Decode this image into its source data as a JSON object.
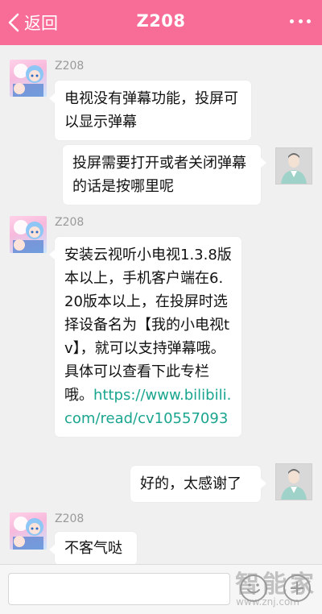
{
  "header": {
    "back_label": "返回",
    "title": "Z208"
  },
  "messages": [
    {
      "sender": "Z208",
      "side": "left",
      "text": "电视没有弹幕功能，投屏可以显示弹幕"
    },
    {
      "sender": "",
      "side": "right",
      "text": "投屏需要打开或者关闭弹幕的话是按哪里呢"
    },
    {
      "sender": "Z208",
      "side": "left",
      "text": "安装云视听小电视1.3.8版本以上，手机客户端在6.20版本以上，在投屏时选择设备名为【我的小电视tv】，就可以支持弹幕哦。具体可以查看下此专栏哦。",
      "link": "https://www.bilibili.com/read/cv10557093"
    },
    {
      "sender": "",
      "side": "right",
      "text": "好的，太感谢了"
    },
    {
      "sender": "Z208",
      "side": "left",
      "text": "不客气哒"
    }
  ],
  "input": {
    "placeholder": "",
    "emoji_icon": "smiley-icon",
    "plus_icon": "plus-icon"
  },
  "watermark": {
    "logo": "智能家",
    "site": "www.znj.com"
  },
  "colors": {
    "header_bg": "#f86d97",
    "link": "#1aa58f",
    "page_bg": "#f0f0f0"
  }
}
